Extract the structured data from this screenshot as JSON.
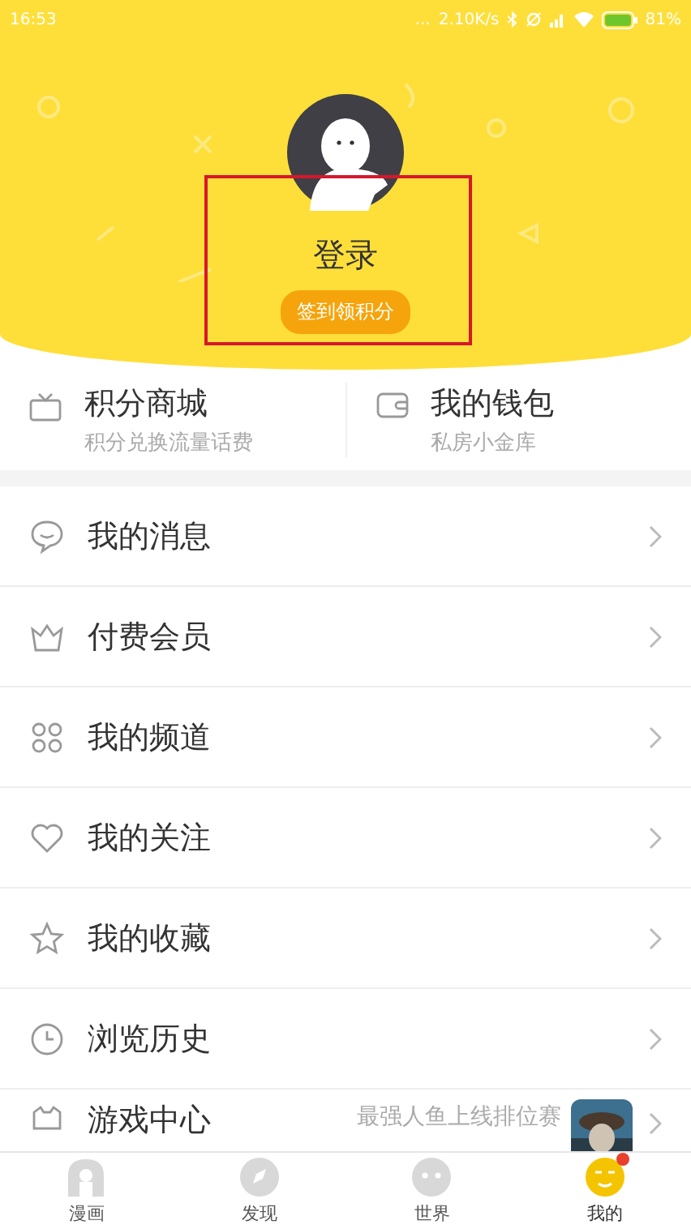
{
  "status_bar": {
    "time": "16:53",
    "dots": "...",
    "speed": "2.10K/s",
    "battery": "81%"
  },
  "profile": {
    "name": "登录",
    "checkin_button": "签到领积分"
  },
  "shortcuts": [
    {
      "kind": "shop",
      "title": "积分商城",
      "subtitle": "积分兑换流量话费"
    },
    {
      "kind": "wallet",
      "title": "我的钱包",
      "subtitle": "私房小金库"
    }
  ],
  "menu": [
    {
      "kind": "message",
      "label": "我的消息"
    },
    {
      "kind": "vip",
      "label": "付费会员"
    },
    {
      "kind": "channel",
      "label": "我的频道"
    },
    {
      "kind": "follow",
      "label": "我的关注"
    },
    {
      "kind": "favorite",
      "label": "我的收藏"
    },
    {
      "kind": "history",
      "label": "浏览历史"
    },
    {
      "kind": "game",
      "label": "游戏中心",
      "detail": "最强人鱼上线排位赛"
    }
  ],
  "tabs": [
    {
      "kind": "comic",
      "label": "漫画",
      "selected": false
    },
    {
      "kind": "discover",
      "label": "发现",
      "selected": false
    },
    {
      "kind": "world",
      "label": "世界",
      "selected": false
    },
    {
      "kind": "me",
      "label": "我的",
      "selected": true,
      "badge": true
    }
  ]
}
